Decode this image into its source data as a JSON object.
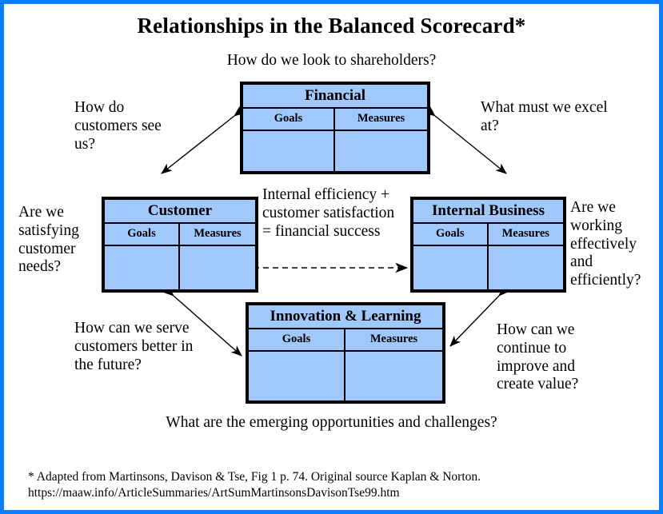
{
  "page": {
    "title": "Relationships in the Balanced Scorecard*",
    "border_color": "#0b7ffb",
    "card_fill_color": "#a0c8fb",
    "background_color": "#ffffff"
  },
  "questions": {
    "top": "How do we look to shareholders?",
    "left_top": "How do customers see us?",
    "right_top": "What must we excel at?",
    "left_middle": "Are we satisfying customer needs?",
    "right_middle": "Are we working effectively and efficiently?",
    "center": "Internal efficiency + customer satisfaction = financial success",
    "left_bottom": "How can we serve customers better in the future?",
    "right_bottom": "How can we continue to improve and create value?",
    "bottom": "What are the emerging opportunities and challenges?"
  },
  "cards": {
    "financial": {
      "title": "Financial",
      "columns": [
        "Goals",
        "Measures"
      ]
    },
    "customer": {
      "title": "Customer",
      "columns": [
        "Goals",
        "Measures"
      ]
    },
    "internal": {
      "title": "Internal Business",
      "columns": [
        "Goals",
        "Measures"
      ]
    },
    "innovation": {
      "title": "Innovation & Learning",
      "columns": [
        "Goals",
        "Measures"
      ]
    }
  },
  "footnote": {
    "line1": "* Adapted from Martinsons, Davison & Tse, Fig 1  p. 74.  Original source Kaplan & Norton.",
    "line2": "https://maaw.info/ArticleSummaries/ArtSumMartinsonsDavisonTse99.htm"
  }
}
